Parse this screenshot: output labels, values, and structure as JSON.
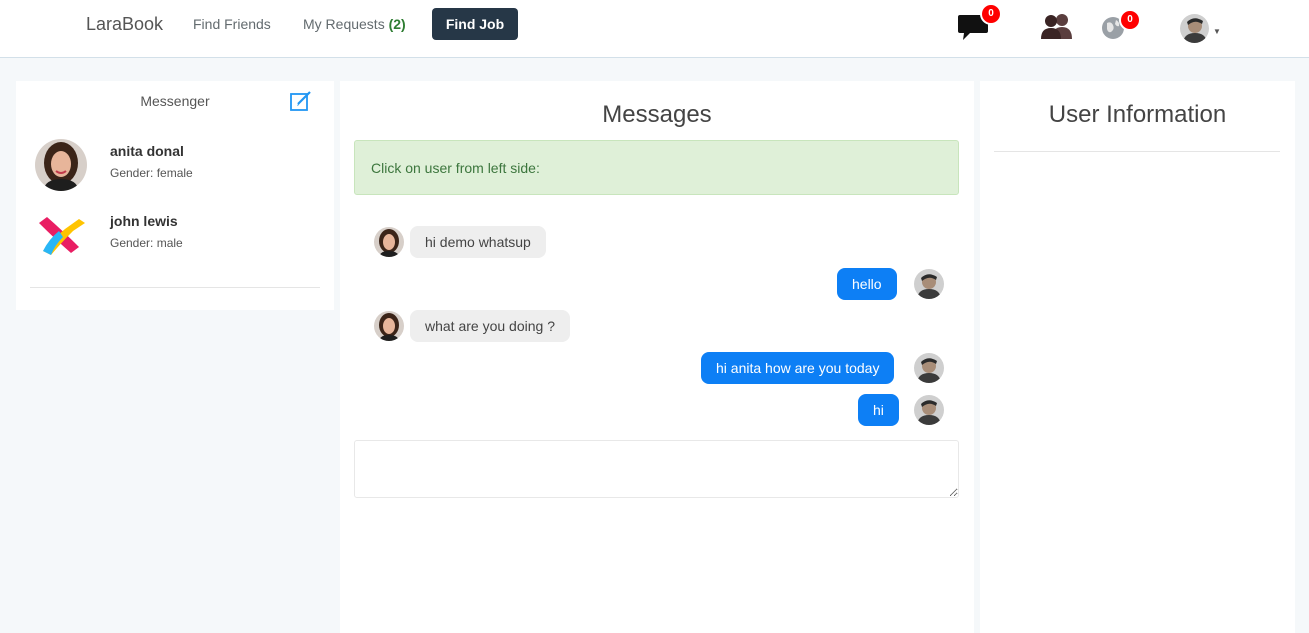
{
  "navbar": {
    "brand": "LaraBook",
    "find_friends": "Find Friends",
    "my_requests": "My Requests",
    "requests_count": "(2)",
    "find_job": "Find Job",
    "messages_badge": "0",
    "notifications_badge": "0",
    "icons": [
      "comment-icon",
      "users-icon",
      "globe-icon",
      "avatar-icon",
      "caret-down-icon"
    ]
  },
  "sidebar": {
    "title": "Messenger",
    "contacts": [
      {
        "name": "anita donal",
        "gender": "Gender: female"
      },
      {
        "name": "john lewis",
        "gender": "Gender: male"
      }
    ]
  },
  "messages": {
    "title": "Messages",
    "alert": "Click on user from left side:",
    "items": [
      {
        "text": "hi demo whatsup",
        "direction": "incoming"
      },
      {
        "text": "hello",
        "direction": "outgoing"
      },
      {
        "text": "what are you doing ?",
        "direction": "incoming"
      },
      {
        "text": "hi anita how are you today",
        "direction": "outgoing"
      },
      {
        "text": "hi",
        "direction": "outgoing"
      }
    ],
    "compose_value": ""
  },
  "user_info": {
    "title": "User Information"
  },
  "colors": {
    "primary_blue": "#0d7ff5",
    "find_job_bg": "#263747",
    "badge_red": "#ff0000",
    "alert_bg": "#dff0d8",
    "requests_green": "#2e7d32"
  }
}
